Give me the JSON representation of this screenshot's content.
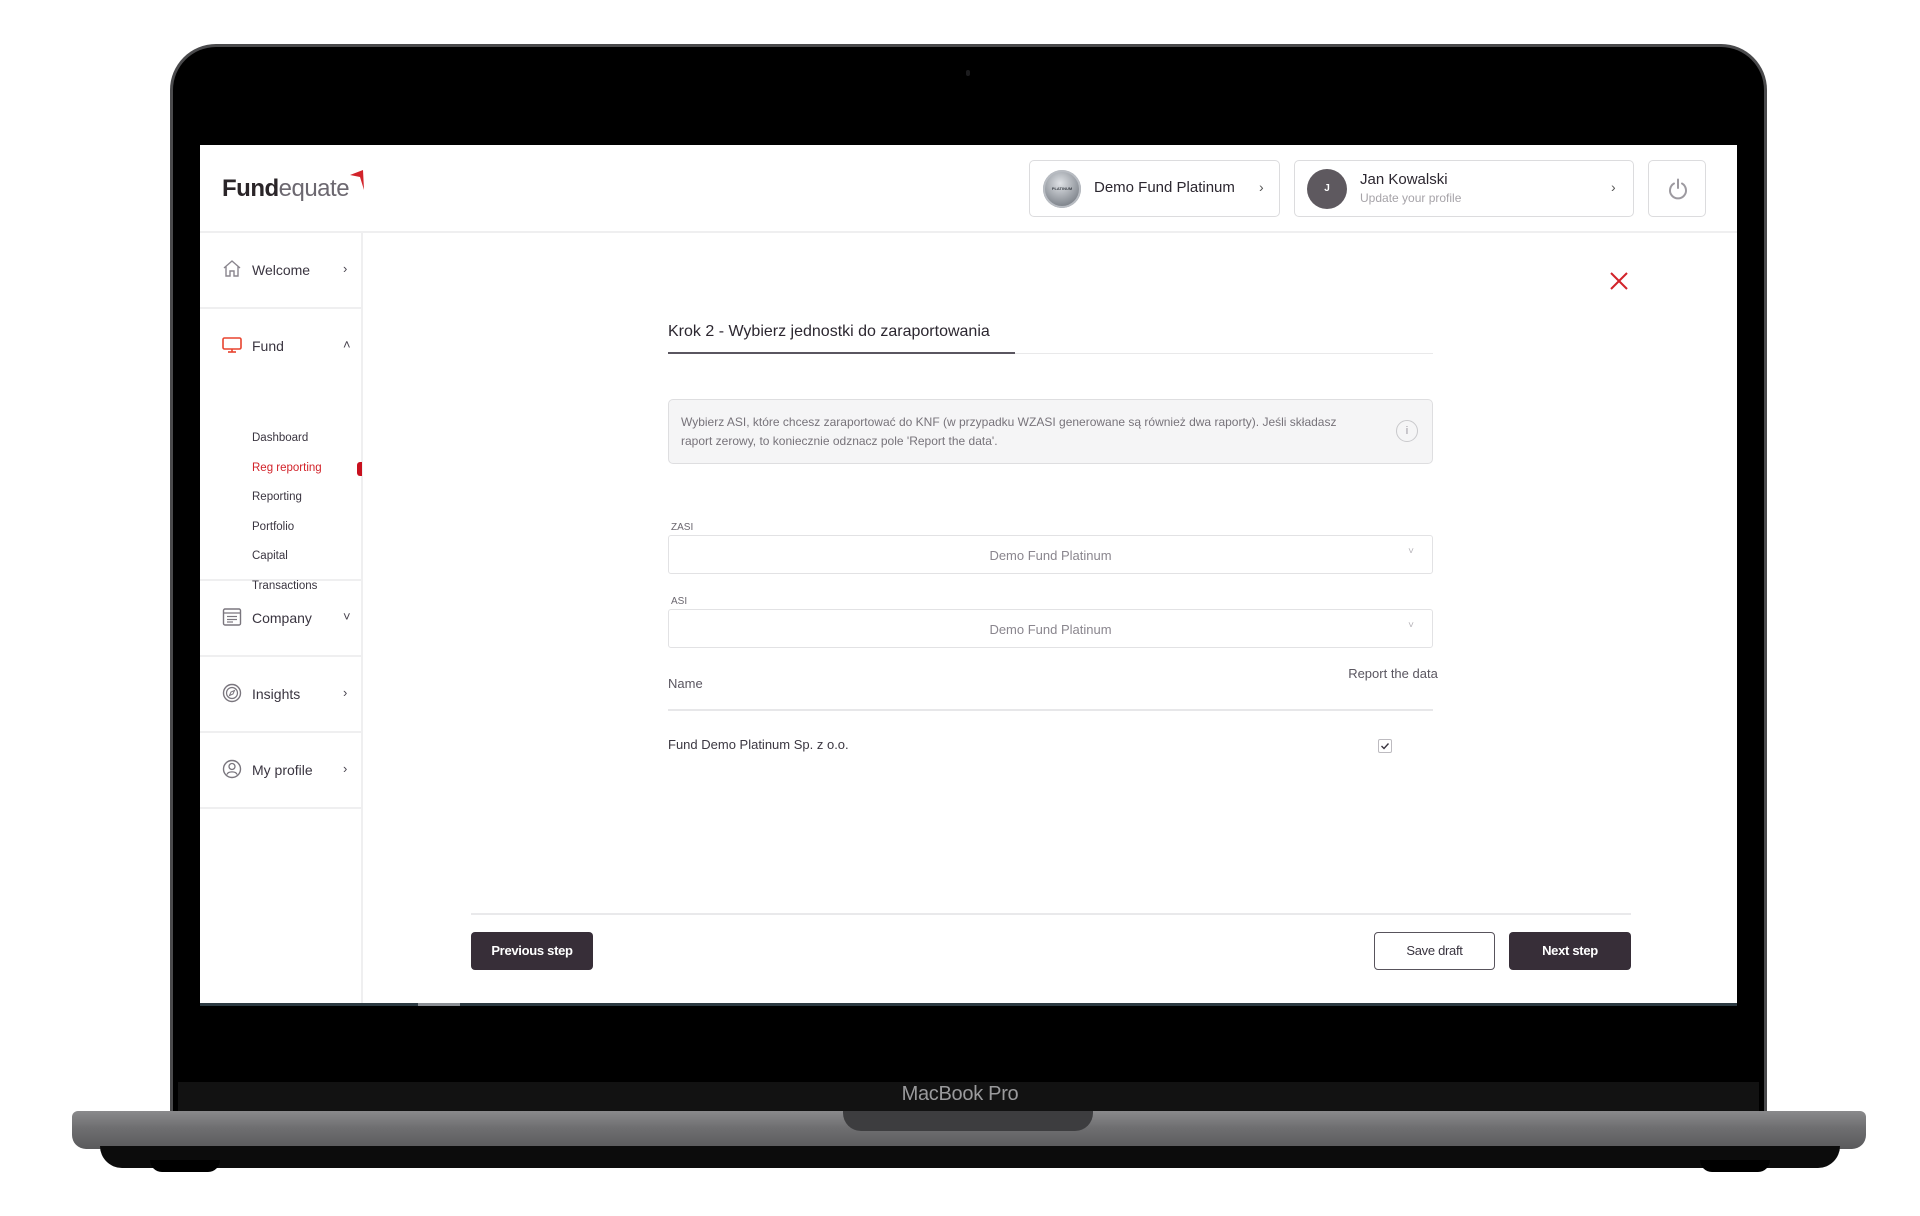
{
  "device": {
    "brand_label": "MacBook Pro"
  },
  "header": {
    "logo": {
      "bold": "Fund",
      "light": "equate"
    },
    "fund_selector": {
      "avatar_text": "PLATINUM",
      "name": "Demo Fund Platinum",
      "chevron": "›"
    },
    "profile": {
      "initial": "J",
      "name": "Jan Kowalski",
      "subtitle": "Update your profile",
      "chevron": "›"
    },
    "power_icon": "power-icon"
  },
  "sidebar": {
    "sections": [
      {
        "label": "Welcome",
        "icon": "home-icon",
        "chevron": "›"
      },
      {
        "label": "Fund",
        "icon": "monitor-icon",
        "chevron": "˄",
        "expanded": true,
        "items": [
          {
            "label": "Dashboard",
            "active": false
          },
          {
            "label": "Reg reporting",
            "active": true
          },
          {
            "label": "Reporting",
            "active": false
          },
          {
            "label": "Portfolio",
            "active": false
          },
          {
            "label": "Capital",
            "active": false
          },
          {
            "label": "Transactions",
            "active": false
          }
        ]
      },
      {
        "label": "Company",
        "icon": "document-icon",
        "chevron": "˅"
      },
      {
        "label": "Insights",
        "icon": "compass-icon",
        "chevron": "›"
      },
      {
        "label": "My profile",
        "icon": "user-icon",
        "chevron": "›"
      }
    ]
  },
  "main": {
    "title": "Krok 2 - Wybierz jednostki do zaraportowania",
    "info_text": "Wybierz ASI, które chcesz zaraportować do KNF (w przypadku WZASI generowane są również dwa raporty). Jeśli składasz raport zerowy, to koniecznie odznacz pole 'Report the data'.",
    "info_icon_glyph": "i",
    "fields": [
      {
        "label": "ZASI",
        "value": "Demo Fund Platinum",
        "chevron": "˅"
      },
      {
        "label": "ASI",
        "value": "Demo Fund Platinum",
        "chevron": "˅"
      }
    ],
    "table": {
      "columns": [
        "Name",
        "Report the data"
      ],
      "rows": [
        {
          "name": "Fund Demo Platinum Sp. z o.o.",
          "report": true
        }
      ]
    },
    "buttons": {
      "previous": "Previous step",
      "save": "Save draft",
      "next": "Next step"
    }
  },
  "colors": {
    "accent": "#d2232a",
    "dark_button": "#372e38"
  }
}
